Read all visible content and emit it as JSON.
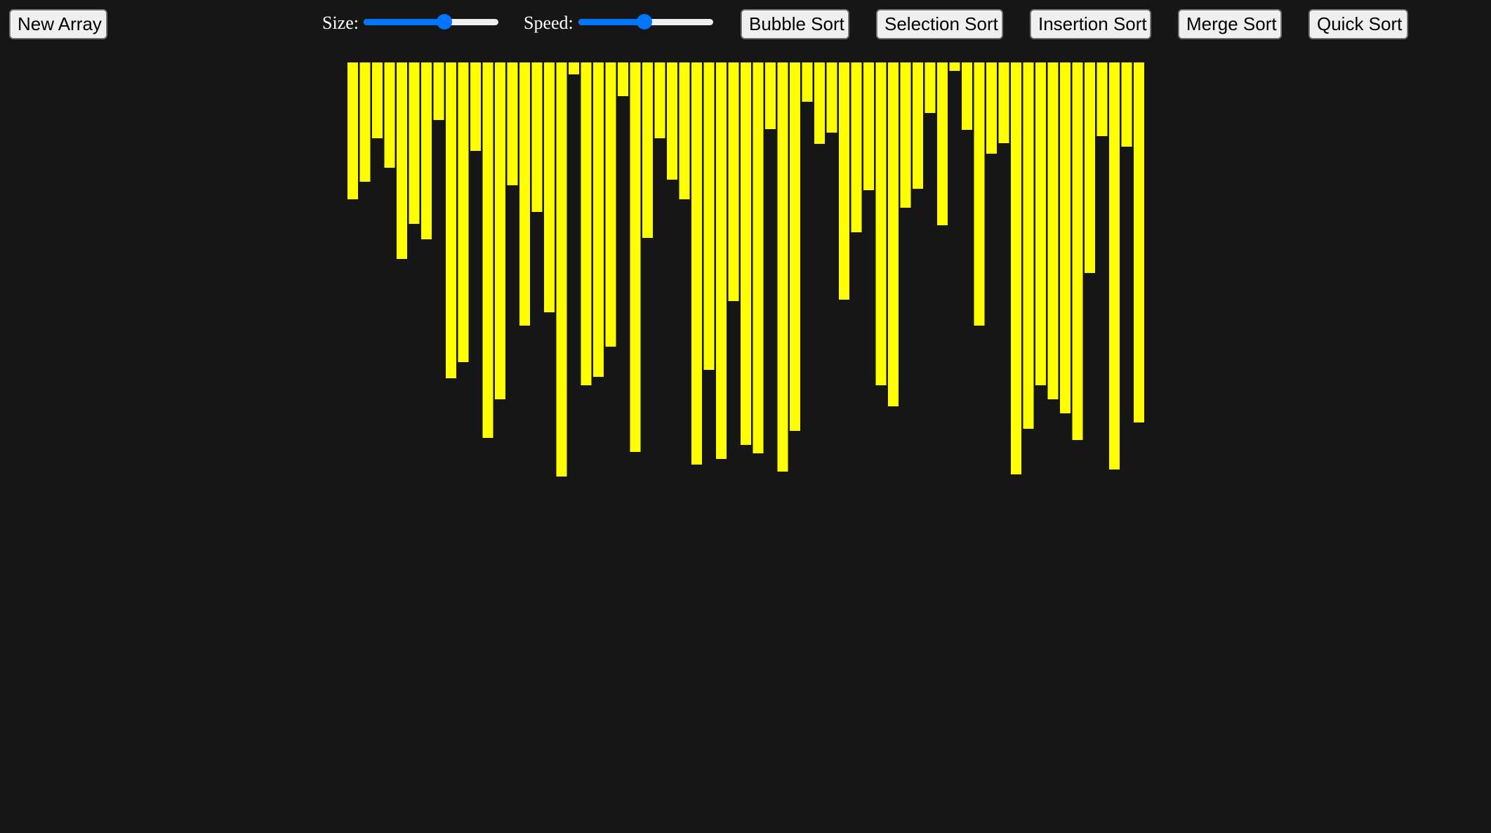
{
  "toolbar": {
    "new_array_label": "New Array",
    "size_label": "Size:",
    "speed_label": "Speed:",
    "size_value": 0.6,
    "speed_value": 0.49,
    "sort_buttons": {
      "bubble": "Bubble Sort",
      "selection": "Selection Sort",
      "insertion": "Insertion Sort",
      "merge": "Merge Sort",
      "quick": "Quick Sort"
    }
  },
  "array": {
    "bar_color": "#ffff00",
    "max_value": 600,
    "values": [
      195,
      170,
      108,
      150,
      280,
      230,
      252,
      82,
      450,
      427,
      126,
      535,
      480,
      175,
      375,
      213,
      356,
      590,
      17,
      460,
      448,
      405,
      48,
      555,
      250,
      108,
      167,
      195,
      573,
      438,
      565,
      340,
      545,
      557,
      95,
      583,
      525,
      56,
      116,
      100,
      338,
      242,
      182,
      460,
      490,
      207,
      180,
      72,
      232,
      12,
      96,
      375,
      130,
      115,
      587,
      522,
      460,
      480,
      500,
      538,
      300,
      105,
      580,
      120,
      513
    ]
  }
}
